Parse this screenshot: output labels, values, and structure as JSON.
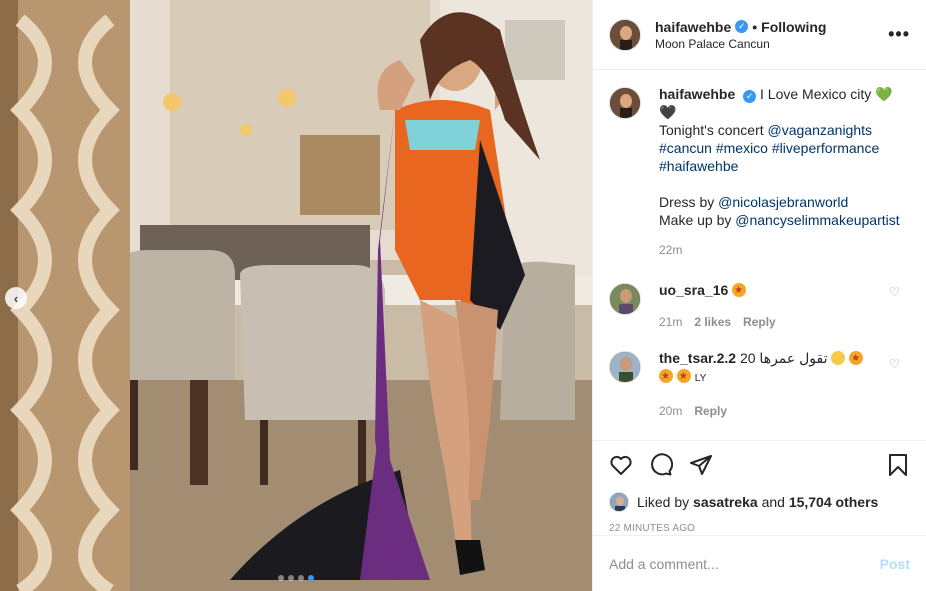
{
  "header": {
    "username": "haifawehbe",
    "verified_icon": "verified-badge-icon",
    "separator": "•",
    "follow_status": "Following",
    "location": "Moon Palace Cancun",
    "more_icon": "more-options-icon"
  },
  "media": {
    "prev_icon": "chevron-left-icon",
    "carousel_count": 4,
    "active_index": 3,
    "nav_glyph": "‹"
  },
  "caption": {
    "username": "haifawehbe",
    "line1_text": "I Love Mexico city",
    "line1_emoji": "💚",
    "line2_emoji": "🖤",
    "concert_prefix": "Tonight's concert",
    "concert_mention": "@vaganzanights",
    "hashtags": [
      "#cancun",
      "#mexico",
      "#liveperformance",
      "#haifawehbe"
    ],
    "dress_prefix": "Dress by",
    "dress_mention": "@nicolasjebranworld",
    "makeup_prefix": "Make up by",
    "makeup_mention": "@nancyselimmakeupartist",
    "time": "22m"
  },
  "comments": [
    {
      "username": "uo_sra_16",
      "text_emoji": "star-struck",
      "time": "21m",
      "likes": "2 likes",
      "reply": "Reply"
    },
    {
      "username": "the_tsar.2.2",
      "text": "20 تقول عمرها",
      "suffix": "LY",
      "time": "20m",
      "reply": "Reply"
    }
  ],
  "actions": {
    "like_icon": "heart-icon",
    "comment_icon": "comment-icon",
    "share_icon": "share-icon",
    "save_icon": "bookmark-icon",
    "liked_prefix": "Liked by",
    "liked_user": "sasatreka",
    "liked_and": "and",
    "liked_count": "15,704 others",
    "timestamp": "22 MINUTES AGO"
  },
  "add_comment": {
    "placeholder": "Add a comment...",
    "post_label": "Post"
  },
  "colors": {
    "link": "#003569",
    "accent": "#3897f0",
    "post_disabled": "#b2dffc",
    "muted": "#8e8e8e"
  }
}
